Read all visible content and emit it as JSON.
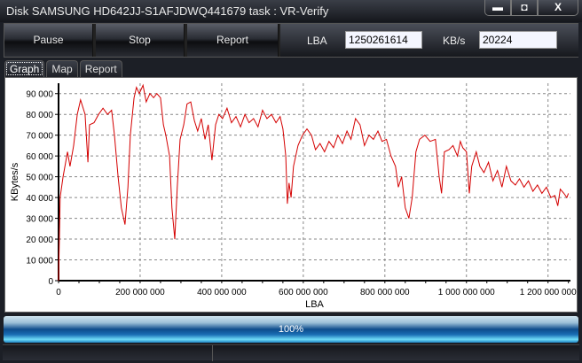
{
  "window": {
    "title": "Disk SAMSUNG HD642JJ-S1AFJDWQ441679   task : VR-Verify",
    "min": "▬",
    "max": "◘",
    "close": "X"
  },
  "toolbar": {
    "pause": "Pause",
    "stop": "Stop",
    "report": "Report",
    "lba_label": "LBA",
    "lba_value": "1250261614",
    "kbs_label": "KB/s",
    "kbs_value": "20224"
  },
  "tabs": [
    {
      "label": "Graph"
    },
    {
      "label": "Map"
    },
    {
      "label": "Report"
    }
  ],
  "progress": {
    "value": 100,
    "label": "100%"
  },
  "chart_data": {
    "type": "line",
    "title": "",
    "xlabel": "LBA",
    "ylabel": "KBytes/s",
    "x_scale": 1000000,
    "xlim": [
      0,
      1255
    ],
    "ylim": [
      0,
      95000
    ],
    "x_ticks": [
      0,
      200,
      400,
      600,
      800,
      1000,
      1200
    ],
    "x_tick_labels": [
      "0",
      "200 000 000",
      "400 000 000",
      "600 000 000",
      "800 000 000",
      "1 000 000 000",
      "1 200 000 000"
    ],
    "y_ticks": [
      0,
      10000,
      20000,
      30000,
      40000,
      50000,
      60000,
      70000,
      80000,
      90000
    ],
    "y_tick_labels": [
      "0",
      "10 000",
      "20 000",
      "30 000",
      "40 000",
      "50 000",
      "60 000",
      "70 000",
      "80 000",
      "90 000"
    ],
    "grid": true,
    "series_color": "#d40000",
    "series": [
      {
        "name": "KB/s",
        "points": [
          [
            0,
            0
          ],
          [
            4,
            40000
          ],
          [
            11,
            50000
          ],
          [
            22,
            62000
          ],
          [
            28,
            55000
          ],
          [
            37,
            65000
          ],
          [
            46,
            80000
          ],
          [
            54,
            87000
          ],
          [
            65,
            80000
          ],
          [
            72,
            57000
          ],
          [
            76,
            75000
          ],
          [
            87,
            76000
          ],
          [
            98,
            80000
          ],
          [
            109,
            83000
          ],
          [
            120,
            80000
          ],
          [
            130,
            82000
          ],
          [
            137,
            70000
          ],
          [
            146,
            50000
          ],
          [
            154,
            35000
          ],
          [
            163,
            27000
          ],
          [
            170,
            45000
          ],
          [
            176,
            70000
          ],
          [
            185,
            88000
          ],
          [
            191,
            93000
          ],
          [
            198,
            90000
          ],
          [
            207,
            94000
          ],
          [
            215,
            86000
          ],
          [
            224,
            90000
          ],
          [
            233,
            88000
          ],
          [
            241,
            90000
          ],
          [
            250,
            88000
          ],
          [
            257,
            75000
          ],
          [
            263,
            70000
          ],
          [
            272,
            60000
          ],
          [
            278,
            35000
          ],
          [
            285,
            20000
          ],
          [
            291,
            45000
          ],
          [
            298,
            68000
          ],
          [
            307,
            75000
          ],
          [
            315,
            85000
          ],
          [
            324,
            86000
          ],
          [
            333,
            77000
          ],
          [
            341,
            72000
          ],
          [
            350,
            78000
          ],
          [
            359,
            68000
          ],
          [
            367,
            75000
          ],
          [
            376,
            58000
          ],
          [
            385,
            75000
          ],
          [
            393,
            80000
          ],
          [
            402,
            78000
          ],
          [
            413,
            83000
          ],
          [
            424,
            76000
          ],
          [
            435,
            79000
          ],
          [
            446,
            74000
          ],
          [
            457,
            80000
          ],
          [
            467,
            76000
          ],
          [
            478,
            78000
          ],
          [
            489,
            74000
          ],
          [
            500,
            82000
          ],
          [
            511,
            78000
          ],
          [
            522,
            80000
          ],
          [
            533,
            76000
          ],
          [
            543,
            79000
          ],
          [
            550,
            73000
          ],
          [
            557,
            60000
          ],
          [
            561,
            37000
          ],
          [
            565,
            47000
          ],
          [
            570,
            40000
          ],
          [
            576,
            55000
          ],
          [
            587,
            65000
          ],
          [
            598,
            70000
          ],
          [
            609,
            73000
          ],
          [
            620,
            70000
          ],
          [
            630,
            63000
          ],
          [
            641,
            66000
          ],
          [
            652,
            62000
          ],
          [
            663,
            67000
          ],
          [
            674,
            64000
          ],
          [
            685,
            70000
          ],
          [
            696,
            66000
          ],
          [
            707,
            72000
          ],
          [
            717,
            68000
          ],
          [
            728,
            78000
          ],
          [
            739,
            75000
          ],
          [
            750,
            65000
          ],
          [
            761,
            70000
          ],
          [
            772,
            68000
          ],
          [
            783,
            72000
          ],
          [
            793,
            67000
          ],
          [
            804,
            68000
          ],
          [
            815,
            60000
          ],
          [
            826,
            55000
          ],
          [
            833,
            45000
          ],
          [
            841,
            50000
          ],
          [
            850,
            35000
          ],
          [
            859,
            30000
          ],
          [
            867,
            40000
          ],
          [
            876,
            62000
          ],
          [
            885,
            68000
          ],
          [
            898,
            70000
          ],
          [
            911,
            67000
          ],
          [
            924,
            68000
          ],
          [
            933,
            50000
          ],
          [
            939,
            42000
          ],
          [
            946,
            62000
          ],
          [
            957,
            63000
          ],
          [
            967,
            65000
          ],
          [
            978,
            60000
          ],
          [
            985,
            67000
          ],
          [
            991,
            64000
          ],
          [
            1000,
            62000
          ],
          [
            1007,
            42000
          ],
          [
            1013,
            55000
          ],
          [
            1024,
            62000
          ],
          [
            1033,
            55000
          ],
          [
            1043,
            52000
          ],
          [
            1054,
            57000
          ],
          [
            1065,
            48000
          ],
          [
            1076,
            53000
          ],
          [
            1087,
            45000
          ],
          [
            1098,
            55000
          ],
          [
            1109,
            48000
          ],
          [
            1120,
            46000
          ],
          [
            1130,
            49000
          ],
          [
            1141,
            45000
          ],
          [
            1152,
            48000
          ],
          [
            1163,
            43000
          ],
          [
            1174,
            46000
          ],
          [
            1185,
            42000
          ],
          [
            1196,
            45000
          ],
          [
            1207,
            40000
          ],
          [
            1217,
            41000
          ],
          [
            1224,
            36000
          ],
          [
            1230,
            44000
          ],
          [
            1239,
            42000
          ],
          [
            1246,
            40000
          ],
          [
            1250,
            42000
          ]
        ]
      }
    ]
  }
}
